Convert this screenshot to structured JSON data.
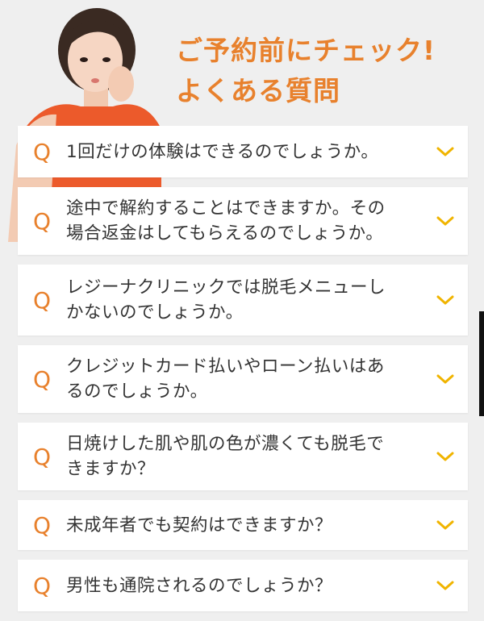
{
  "header": {
    "title_line1": "ご予約前にチェック!",
    "title_line2": "よくある質問"
  },
  "faq": {
    "q_label": "Q",
    "items": [
      {
        "question_lines": [
          "1回だけの体験はできるのでしょうか。"
        ]
      },
      {
        "question_lines": [
          "途中で解約することはできますか。その",
          "場合返金はしてもらえるのでしょうか。"
        ]
      },
      {
        "question_lines": [
          "レジーナクリニックでは脱毛メニューし",
          "かないのでしょうか。"
        ]
      },
      {
        "question_lines": [
          "クレジットカード払いやローン払いはあ",
          "るのでしょうか。"
        ]
      },
      {
        "question_lines": [
          "日焼けした肌や肌の色が濃くても脱毛で",
          "きますか？"
        ]
      },
      {
        "question_lines": [
          "未成年者でも契約はできますか？"
        ]
      },
      {
        "question_lines": [
          "男性も通院されるのでしょうか？"
        ]
      }
    ]
  },
  "colors": {
    "accent": "#e8812d",
    "chevron": "#f0b400",
    "background": "#efefef",
    "card": "#ffffff",
    "text": "#333333"
  },
  "icons": {
    "expand": "chevron-down-icon"
  }
}
